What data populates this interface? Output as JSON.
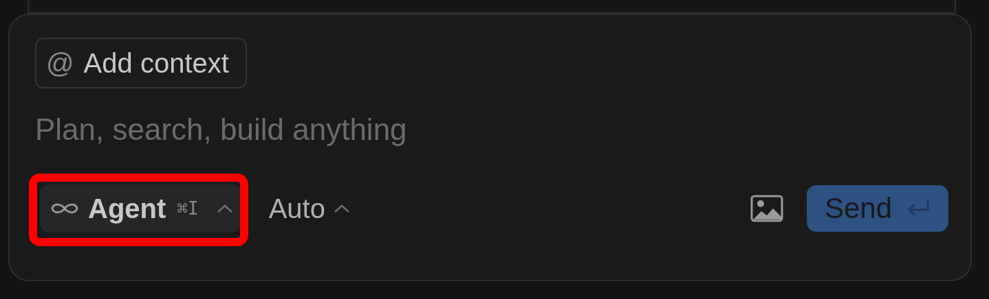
{
  "context_button": {
    "icon": "@",
    "label": "Add context"
  },
  "prompt": {
    "placeholder": "Plan, search, build anything"
  },
  "mode_button": {
    "label": "Agent",
    "shortcut": "⌘I",
    "highlighted": true
  },
  "model_button": {
    "label": "Auto"
  },
  "send_button": {
    "label": "Send"
  }
}
